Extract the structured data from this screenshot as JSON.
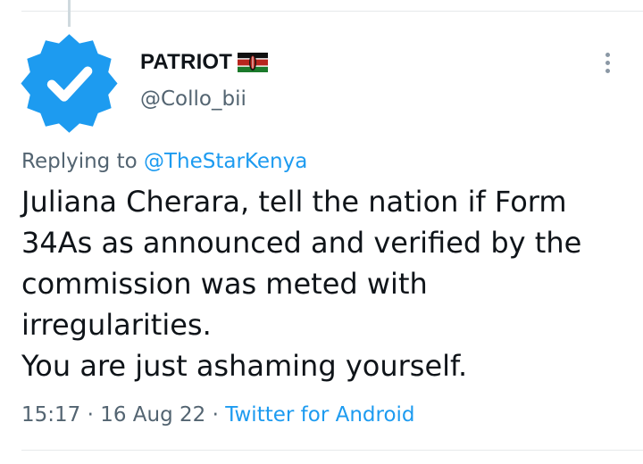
{
  "author": {
    "display_name": "PATRIOT",
    "handle": "@Collo_bii",
    "avatar_icon": "verified-badge-icon",
    "flag_icon": "kenya-flag-icon"
  },
  "reply": {
    "prefix": "Replying to",
    "to_handle": "@TheStarKenya"
  },
  "tweet": {
    "lines": [
      "Juliana Cherara, tell the nation if Form",
      "34As as announced and verified by the",
      "commission was meted with",
      "irregularities.",
      "You are just ashaming yourself."
    ]
  },
  "meta": {
    "time": "15:17",
    "separator": "·",
    "date": "16 Aug 22",
    "source": "Twitter for Android"
  },
  "colors": {
    "accent": "#1d9bf0",
    "secondary_text": "#536471",
    "primary_text": "#0f1419"
  },
  "actions": {
    "more_icon": "more-vertical-icon"
  }
}
